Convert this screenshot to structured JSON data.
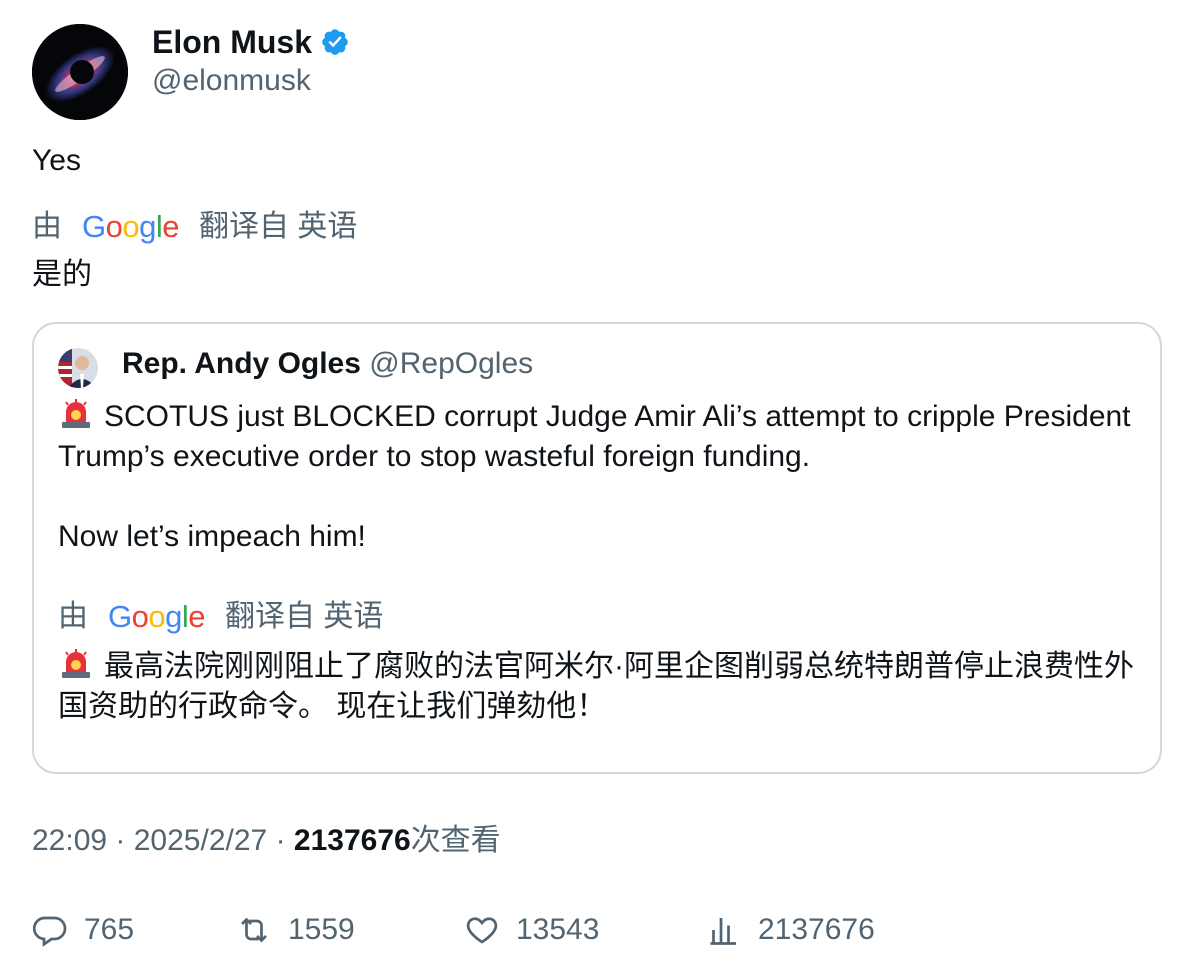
{
  "author": {
    "name": "Elon Musk",
    "handle": "@elonmusk",
    "verified": true
  },
  "tweet": {
    "text": "Yes",
    "translation_prefix": "由",
    "translation_brand": "Google",
    "translation_suffix": "翻译自 英语",
    "translated_text": "是的"
  },
  "quote": {
    "name": "Rep. Andy Ogles",
    "handle": "@RepOgles",
    "text": "SCOTUS just BLOCKED corrupt Judge Amir Ali’s attempt to cripple President Trump’s executive order to stop wasteful foreign funding.\n\nNow let’s impeach him!",
    "translation_prefix": "由",
    "translation_brand": "Google",
    "translation_suffix": "翻译自 英语",
    "translated_text": "最高法院刚刚阻止了腐败的法官阿米尔·阿里企图削弱总统特朗普停止浪费性外国资助的行政命令。 现在让我们弹劾他！"
  },
  "meta": {
    "time": "22:09",
    "date": "2025/2/27",
    "views": "2137676",
    "views_suffix": "次查看"
  },
  "actions": {
    "replies": "765",
    "reposts": "1559",
    "likes": "13543",
    "views": "2137676"
  },
  "colors": {
    "text_primary": "#0f1419",
    "text_secondary": "#536471",
    "verified_blue": "#1d9bf0",
    "border": "#cfd9de"
  }
}
